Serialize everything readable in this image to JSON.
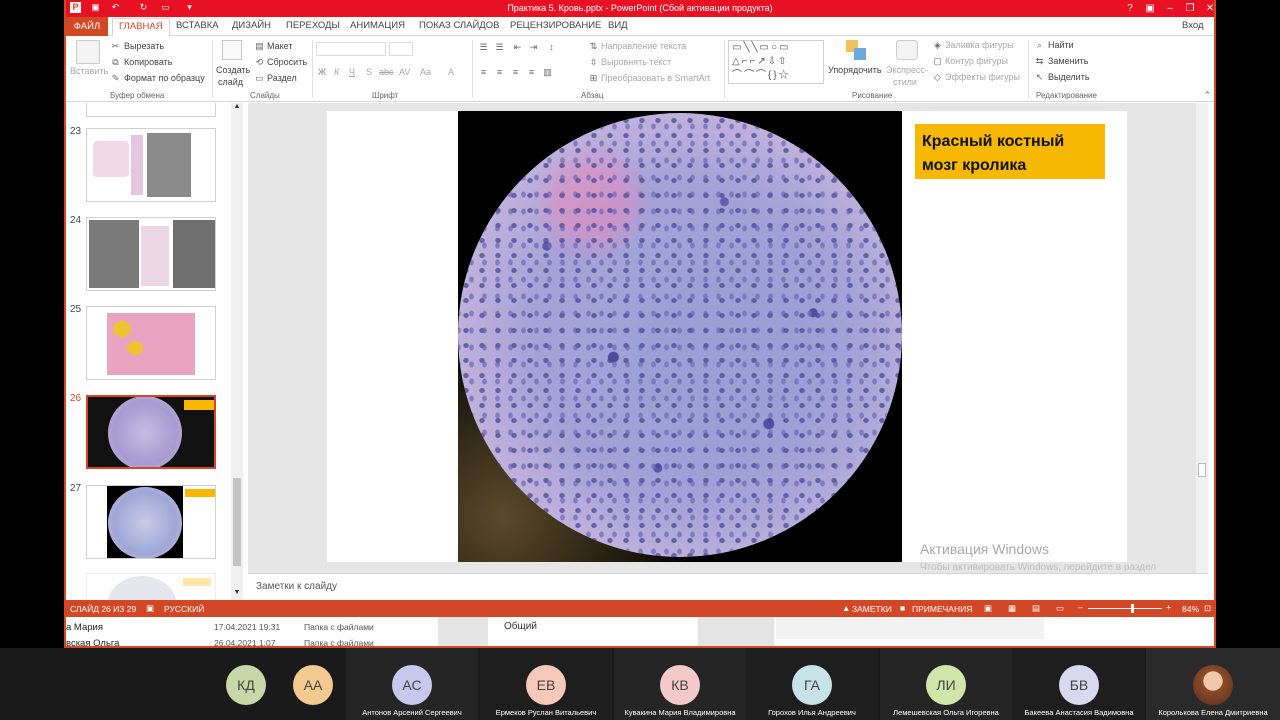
{
  "window": {
    "title": "Практика 5. Кровь.pptx -  PowerPoint (Сбой активации продукта)",
    "user": "Вход",
    "help": "?",
    "title_color": "#e81123",
    "accent_color": "#d24726"
  },
  "tabs": [
    {
      "label": "ФАЙЛ"
    },
    {
      "label": "ГЛАВНАЯ"
    },
    {
      "label": "ВСТАВКА"
    },
    {
      "label": "ДИЗАЙН"
    },
    {
      "label": "ПЕРЕХОДЫ"
    },
    {
      "label": "АНИМАЦИЯ"
    },
    {
      "label": "ПОКАЗ СЛАЙДОВ"
    },
    {
      "label": "РЕЦЕНЗИРОВАНИЕ"
    },
    {
      "label": "ВИД"
    }
  ],
  "ribbon": {
    "clipboard": {
      "paste": "Вставить",
      "cut": "Вырезать",
      "copy": "Копировать",
      "format_painter": "Формат по образцу",
      "group": "Буфер обмена"
    },
    "slides": {
      "new_slide_1": "Создать",
      "new_slide_2": "слайд",
      "layout": "Макет",
      "reset": "Сбросить",
      "section": "Раздел",
      "group": "Слайды"
    },
    "font": {
      "bold": "Ж",
      "italic": "К",
      "underline": "Ч",
      "shadow": "S",
      "strike": "abc",
      "spacing": "AV",
      "case": "Aa",
      "color": "A",
      "group": "Шрифт"
    },
    "paragraph": {
      "text_direction": "Направление текста",
      "align_text": "Выровнять текст",
      "smartart": "Преобразовать в SmartArt",
      "group": "Абзац"
    },
    "drawing": {
      "arrange": "Упорядочить",
      "styles_1": "Экспресс-",
      "styles_2": "стили",
      "fill": "Заливка фигуры",
      "outline": "Контур фигуры",
      "effects": "Эффекты фигуры",
      "group": "Рисование"
    },
    "editing": {
      "find": "Найти",
      "replace": "Заменить",
      "select": "Выделить",
      "group": "Редактирование"
    }
  },
  "thumbnails": [
    {
      "num": "23"
    },
    {
      "num": "24"
    },
    {
      "num": "25"
    },
    {
      "num": "26"
    },
    {
      "num": "27"
    }
  ],
  "slide": {
    "caption": "Красный костный мозг кролика",
    "caption_bg": "#f6b800"
  },
  "activation": {
    "title": "Активация Windows",
    "sub": "Чтобы активировать Windows, перейдите в раздел \"Параметры\"."
  },
  "notes_placeholder": "Заметки к слайду",
  "status": {
    "slide": "СЛАЙД 26 ИЗ 29",
    "language": "РУССКИЙ",
    "notes": "ЗАМЕТКИ",
    "comments": "ПРИМЕЧАНИЯ",
    "zoom": "84%",
    "zoom_level": 0.6
  },
  "background_files": [
    {
      "name": "а Мария",
      "date": "17.04.2021 19:31",
      "type": "Папка с файлами"
    },
    {
      "name": "вская Ольга",
      "date": "26.04.2021 1:07",
      "type": "Папка с файлами"
    }
  ],
  "background_channel": "Общий",
  "participants": [
    {
      "initials": "КД",
      "name": "",
      "color": "#c7d7a8"
    },
    {
      "initials": "АА",
      "name": "",
      "color": "#f2c98f"
    },
    {
      "initials": "АС",
      "name": "Антонов Арсений Сергеевич",
      "color": "#c8c8ec"
    },
    {
      "initials": "ЕВ",
      "name": "Ермеков Руслан Витальевич",
      "color": "#f5c8b8"
    },
    {
      "initials": "КВ",
      "name": "Кувакина Мария Владимировна",
      "color": "#f4c9c9"
    },
    {
      "initials": "ГА",
      "name": "Горохов Илья Андреевич",
      "color": "#c8e2ea"
    },
    {
      "initials": "ЛИ",
      "name": "Лемешевская Ольга Игоревна",
      "color": "#cfe6a8"
    },
    {
      "initials": "БВ",
      "name": "Бакеева Анастасия Вадимовна",
      "color": "#d8d8ee"
    },
    {
      "initials": "",
      "name": "Королькова Елена Дмитриевна",
      "color": "#8a4b2a"
    }
  ]
}
